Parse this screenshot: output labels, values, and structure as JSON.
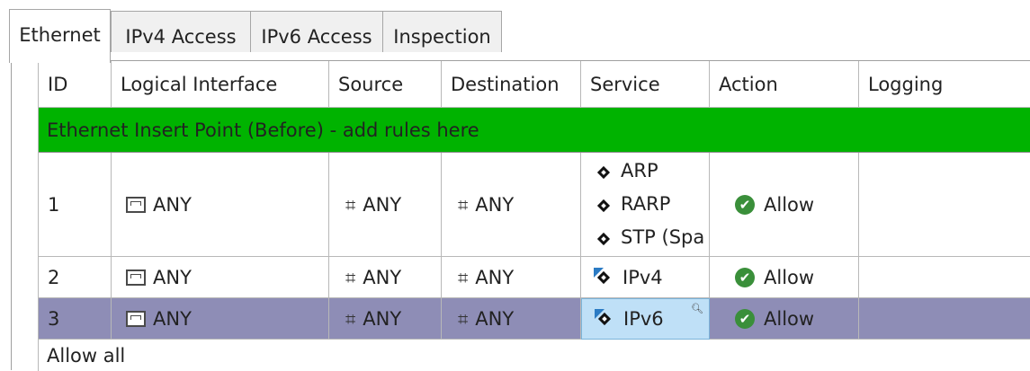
{
  "tabs": [
    {
      "label": "Ethernet",
      "active": true
    },
    {
      "label": "IPv4 Access"
    },
    {
      "label": "IPv6 Access"
    },
    {
      "label": "Inspection"
    }
  ],
  "columns": [
    "ID",
    "Logical Interface",
    "Source",
    "Destination",
    "Service",
    "Action",
    "Logging"
  ],
  "insert_point": "Ethernet Insert Point (Before) - add rules here",
  "rows": [
    {
      "id": "1",
      "interface": "ANY",
      "source": "ANY",
      "destination": "ANY",
      "services": [
        "ARP",
        "RARP",
        "STP (Spa"
      ],
      "action": "Allow",
      "logging": ""
    },
    {
      "id": "2",
      "interface": "ANY",
      "source": "ANY",
      "destination": "ANY",
      "services": [
        "IPv4"
      ],
      "action": "Allow",
      "logging": ""
    },
    {
      "id": "3",
      "interface": "ANY",
      "source": "ANY",
      "destination": "ANY",
      "services": [
        "IPv6"
      ],
      "action": "Allow",
      "logging": "",
      "selected": true
    }
  ],
  "footer": "Allow all",
  "colors": {
    "insert_bg": "#00b300",
    "selected_row": "#8e8db6",
    "selected_cell": "#bfe0f7",
    "allow": "#3a8f3a"
  }
}
